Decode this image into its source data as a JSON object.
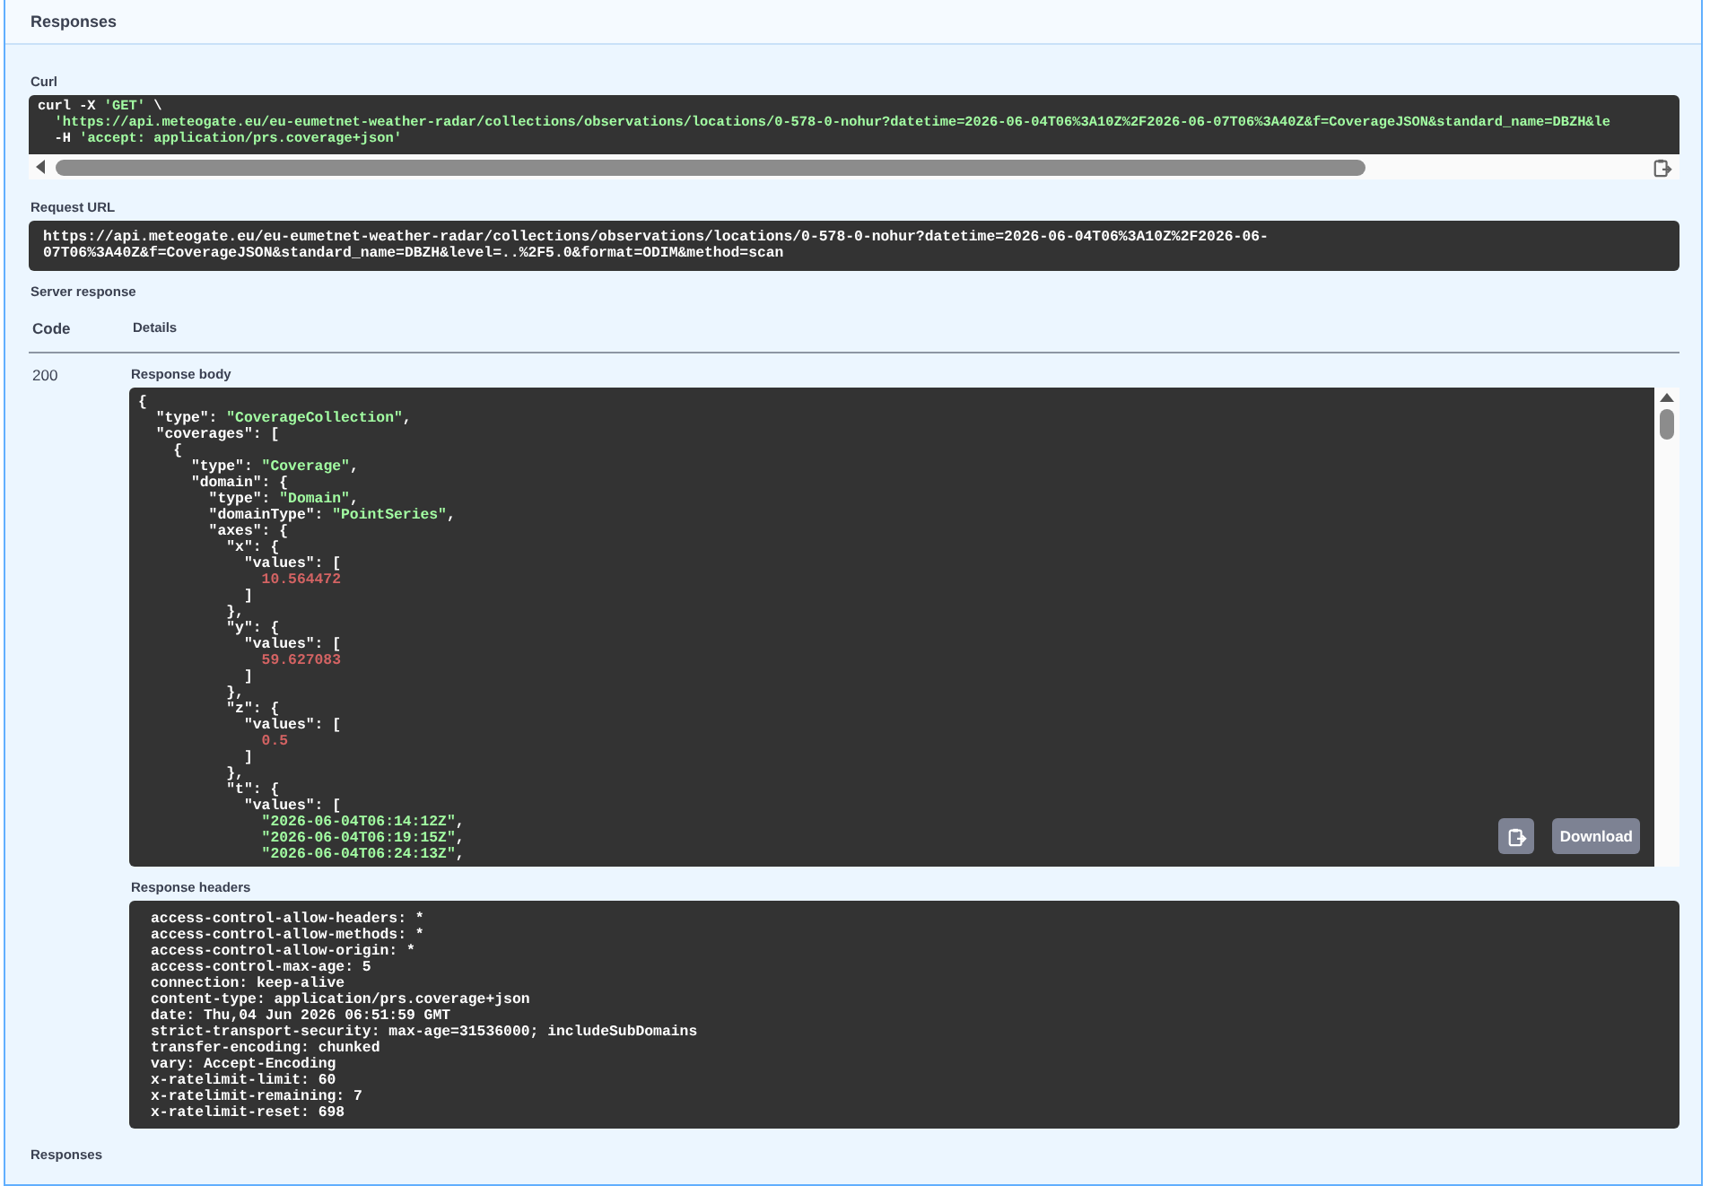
{
  "section_title": "Responses",
  "curl": {
    "label": "Curl",
    "lines": [
      [
        {
          "kind": "plain",
          "text": "curl -X "
        },
        {
          "kind": "string",
          "text": "'GET'"
        },
        {
          "kind": "plain",
          "text": " \\"
        }
      ],
      [
        {
          "kind": "string",
          "text": "  'https://api.meteogate.eu/eu-eumetnet-weather-radar/collections/observations/locations/0-578-0-nohur?datetime=2026-06-04T06%3A10Z%2F2026-06-07T06%3A40Z&f=CoverageJSON&standard_name=DBZH&le"
        }
      ],
      [
        {
          "kind": "plain",
          "text": "  -H "
        },
        {
          "kind": "string",
          "text": "'accept: application/prs.coverage+json'"
        }
      ]
    ]
  },
  "request_url": {
    "label": "Request URL",
    "lines": [
      "https://api.meteogate.eu/eu-eumetnet-weather-radar/collections/observations/locations/0-578-0-nohur?datetime=2026-06-04T06%3A10Z%2F2026-06-",
      "07T06%3A40Z&f=CoverageJSON&standard_name=DBZH&level=..%2F5.0&format=ODIM&method=scan"
    ]
  },
  "server_response": {
    "label": "Server response",
    "columns": [
      "Code",
      "Details"
    ],
    "code": "200",
    "body_label": "Response body",
    "body_lines": [
      [
        {
          "kind": "plain",
          "text": "{"
        }
      ],
      [
        {
          "kind": "plain",
          "text": "  \"type\": "
        },
        {
          "kind": "string",
          "text": "\"CoverageCollection\""
        },
        {
          "kind": "plain",
          "text": ","
        }
      ],
      [
        {
          "kind": "plain",
          "text": "  \"coverages\": ["
        }
      ],
      [
        {
          "kind": "plain",
          "text": "    {"
        }
      ],
      [
        {
          "kind": "plain",
          "text": "      \"type\": "
        },
        {
          "kind": "string",
          "text": "\"Coverage\""
        },
        {
          "kind": "plain",
          "text": ","
        }
      ],
      [
        {
          "kind": "plain",
          "text": "      \"domain\": {"
        }
      ],
      [
        {
          "kind": "plain",
          "text": "        \"type\": "
        },
        {
          "kind": "string",
          "text": "\"Domain\""
        },
        {
          "kind": "plain",
          "text": ","
        }
      ],
      [
        {
          "kind": "plain",
          "text": "        \"domainType\": "
        },
        {
          "kind": "string",
          "text": "\"PointSeries\""
        },
        {
          "kind": "plain",
          "text": ","
        }
      ],
      [
        {
          "kind": "plain",
          "text": "        \"axes\": {"
        }
      ],
      [
        {
          "kind": "plain",
          "text": "          \"x\": {"
        }
      ],
      [
        {
          "kind": "plain",
          "text": "            \"values\": ["
        }
      ],
      [
        {
          "kind": "number",
          "text": "              10.564472"
        }
      ],
      [
        {
          "kind": "plain",
          "text": "            ]"
        }
      ],
      [
        {
          "kind": "plain",
          "text": "          },"
        }
      ],
      [
        {
          "kind": "plain",
          "text": "          \"y\": {"
        }
      ],
      [
        {
          "kind": "plain",
          "text": "            \"values\": ["
        }
      ],
      [
        {
          "kind": "number",
          "text": "              59.627083"
        }
      ],
      [
        {
          "kind": "plain",
          "text": "            ]"
        }
      ],
      [
        {
          "kind": "plain",
          "text": "          },"
        }
      ],
      [
        {
          "kind": "plain",
          "text": "          \"z\": {"
        }
      ],
      [
        {
          "kind": "plain",
          "text": "            \"values\": ["
        }
      ],
      [
        {
          "kind": "number",
          "text": "              0.5"
        }
      ],
      [
        {
          "kind": "plain",
          "text": "            ]"
        }
      ],
      [
        {
          "kind": "plain",
          "text": "          },"
        }
      ],
      [
        {
          "kind": "plain",
          "text": "          \"t\": {"
        }
      ],
      [
        {
          "kind": "plain",
          "text": "            \"values\": ["
        }
      ],
      [
        {
          "kind": "string",
          "text": "              \"2026-06-04T06:14:12Z\""
        },
        {
          "kind": "plain",
          "text": ","
        }
      ],
      [
        {
          "kind": "string",
          "text": "              \"2026-06-04T06:19:15Z\""
        },
        {
          "kind": "plain",
          "text": ","
        }
      ],
      [
        {
          "kind": "string",
          "text": "              \"2026-06-04T06:24:13Z\""
        },
        {
          "kind": "plain",
          "text": ","
        }
      ]
    ],
    "download_button": "Download",
    "headers_label": "Response headers",
    "headers": [
      "access-control-allow-headers: *",
      "access-control-allow-methods: *",
      "access-control-allow-origin: *",
      "access-control-max-age: 5",
      "connection: keep-alive",
      "content-type: application/prs.coverage+json",
      "date: Thu,04 Jun 2026 06:51:59 GMT",
      "strict-transport-security: max-age=31536000; includeSubDomains",
      "transfer-encoding: chunked",
      "vary: Accept-Encoding",
      "x-ratelimit-limit: 60",
      "x-ratelimit-remaining: 7",
      "x-ratelimit-reset: 698"
    ]
  },
  "footer_title": "Responses"
}
